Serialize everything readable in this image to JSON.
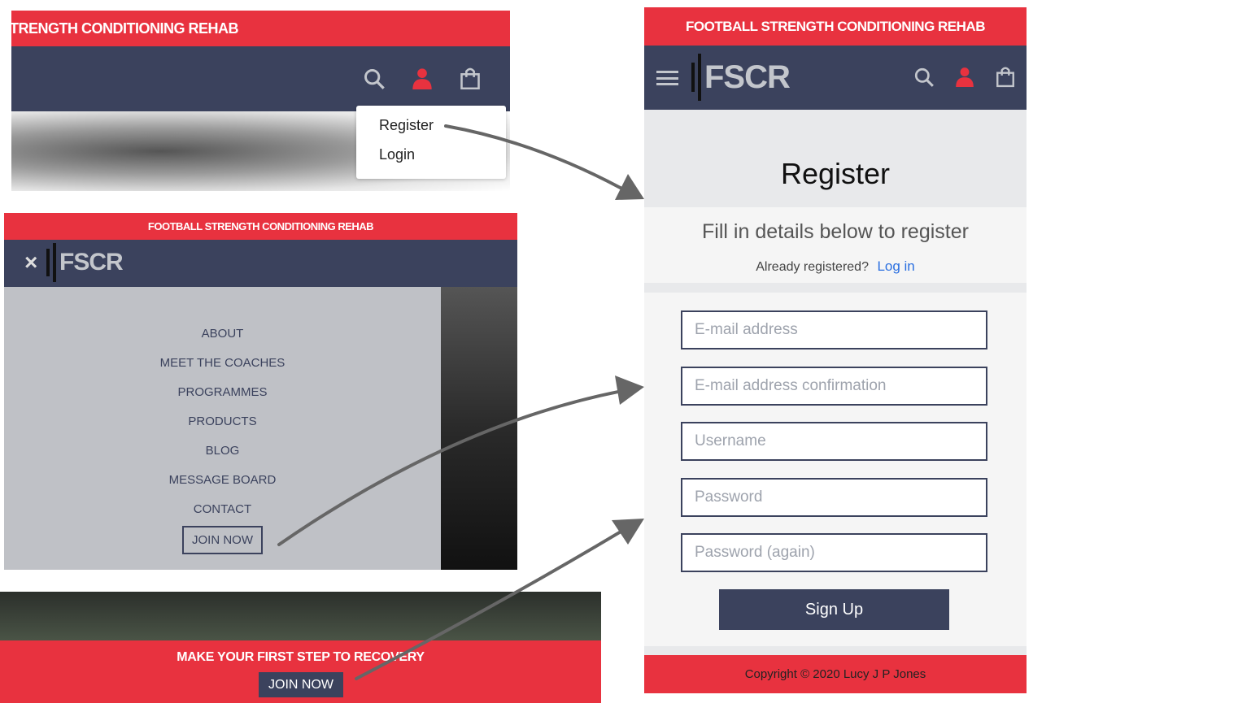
{
  "brand": {
    "tagline": "FOOTBALL STRENGTH CONDITIONING REHAB",
    "tagline_cropped": "TRENGTH CONDITIONING REHAB",
    "logo_text": "FSCR"
  },
  "colors": {
    "red": "#e8323f",
    "navy": "#3b425d",
    "link": "#2a6fe0"
  },
  "header_icons": [
    "search-icon",
    "user-icon",
    "shopping-bag-icon",
    "hamburger-menu-icon",
    "close-icon"
  ],
  "account_dropdown": {
    "items": [
      "Register",
      "Login"
    ]
  },
  "mobile_menu": {
    "close": "×",
    "items": [
      "ABOUT",
      "MEET THE COACHES",
      "PROGRAMMES",
      "PRODUCTS",
      "BLOG",
      "MESSAGE BOARD",
      "CONTACT"
    ],
    "join": "JOIN NOW"
  },
  "cta_banner": {
    "text": "MAKE YOUR FIRST STEP TO RECOVERY",
    "button": "JOIN NOW"
  },
  "register_page": {
    "title": "Register",
    "subtitle": "Fill in details below to register",
    "already": "Already registered?",
    "login_link": "Log in",
    "fields": [
      {
        "placeholder": "E-mail address"
      },
      {
        "placeholder": "E-mail address confirmation"
      },
      {
        "placeholder": "Username"
      },
      {
        "placeholder": "Password"
      },
      {
        "placeholder": "Password (again)"
      }
    ],
    "submit": "Sign Up",
    "footer": "Copyright © 2020 Lucy J P Jones"
  }
}
